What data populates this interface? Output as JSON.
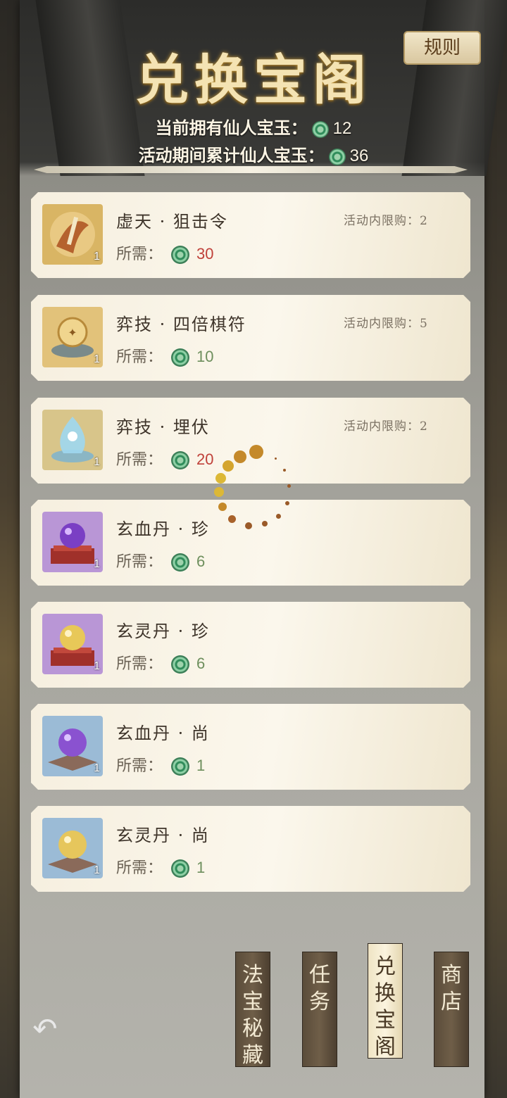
{
  "header": {
    "title": "兑换宝阁",
    "rules_label": "规则",
    "owned_label": "当前拥有仙人宝玉：",
    "owned_value": "12",
    "accum_label": "活动期间累计仙人宝玉：",
    "accum_value": "36"
  },
  "items": [
    {
      "name": "虚天 · 狙击令",
      "limit": "活动内限购：2",
      "cost_label": "所需：",
      "cost": "30",
      "qty": "1"
    },
    {
      "name": "弈技 · 四倍棋符",
      "limit": "活动内限购：5",
      "cost_label": "所需：",
      "cost": "10",
      "qty": "1"
    },
    {
      "name": "弈技 · 埋伏",
      "limit": "活动内限购：2",
      "cost_label": "所需：",
      "cost": "20",
      "qty": "1"
    },
    {
      "name": "玄血丹 · 珍",
      "limit": "",
      "cost_label": "所需：",
      "cost": "6",
      "qty": "1"
    },
    {
      "name": "玄灵丹 · 珍",
      "limit": "",
      "cost_label": "所需：",
      "cost": "6",
      "qty": "1"
    },
    {
      "name": "玄血丹 · 尚",
      "limit": "",
      "cost_label": "所需：",
      "cost": "1",
      "qty": "1"
    },
    {
      "name": "玄灵丹 · 尚",
      "limit": "",
      "cost_label": "所需：",
      "cost": "1",
      "qty": "1"
    }
  ],
  "tabs": [
    {
      "label": "法宝秘藏",
      "active": false
    },
    {
      "label": "任务",
      "active": false
    },
    {
      "label": "兑换宝阁",
      "active": true
    },
    {
      "label": "商店",
      "active": false
    }
  ],
  "icons": {
    "currency": "jade-coin-icon",
    "back": "back-arrow-icon"
  },
  "colors": {
    "cost_red": "#c0413a",
    "cost_green": "#6e8f5d",
    "title_gold": "#f4e3b3"
  }
}
